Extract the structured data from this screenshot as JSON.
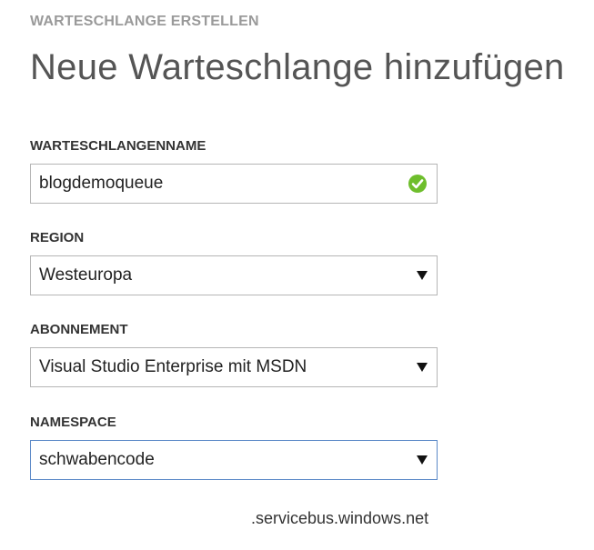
{
  "header": {
    "step_title": "WARTESCHLANGE ERSTELLEN",
    "page_title": "Neue Warteschlange hinzufügen"
  },
  "form": {
    "queue_name": {
      "label": "WARTESCHLANGENNAME",
      "value": "blogdemoqueue",
      "status_icon": "check-circle-icon",
      "status_color": "#6ebe2c"
    },
    "region": {
      "label": "REGION",
      "selected": "Westeuropa"
    },
    "subscription": {
      "label": "ABONNEMENT",
      "selected": "Visual Studio Enterprise mit MSDN"
    },
    "namespace": {
      "label": "NAMESPACE",
      "selected": "schwabencode",
      "suffix": ".servicebus.windows.net",
      "focus_color": "#5b89c7"
    }
  }
}
